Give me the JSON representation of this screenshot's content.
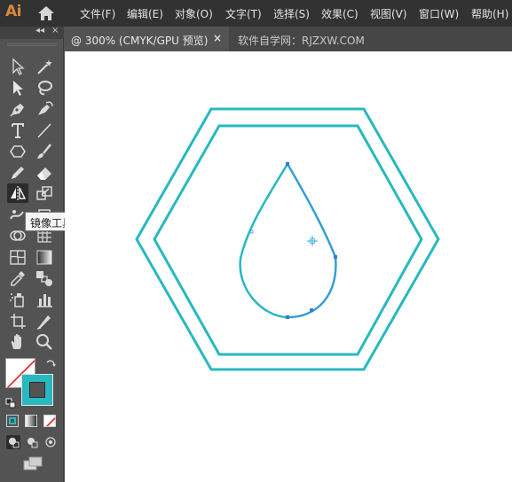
{
  "app": {
    "logo": "Ai"
  },
  "menu": [
    {
      "label": "文件(F)"
    },
    {
      "label": "编辑(E)"
    },
    {
      "label": "对象(O)"
    },
    {
      "label": "文字(T)"
    },
    {
      "label": "选择(S)"
    },
    {
      "label": "效果(C)"
    },
    {
      "label": "视图(V)"
    },
    {
      "label": "窗口(W)"
    },
    {
      "label": "帮助(H)"
    }
  ],
  "tabs": {
    "active_label": "@ 300% (CMYK/GPU 预览)",
    "close_glyph": "×",
    "inactive_label": "软件自学网：RJZXW.COM"
  },
  "toolbar": {
    "collapse_glyph": "◂◂",
    "close_glyph": "×",
    "tooltip": "镜像工具 (O)",
    "tools": [
      {
        "name": "selection-tool",
        "icon": "direct-selection-arrow-outline",
        "interactable": true
      },
      {
        "name": "magic-wand-tool",
        "icon": "magic-wand-icon",
        "interactable": true
      },
      {
        "name": "direct-selection-tool",
        "icon": "solid-arrow-icon",
        "interactable": true
      },
      {
        "name": "lasso-tool",
        "icon": "lasso-icon",
        "interactable": true
      },
      {
        "name": "pen-tool",
        "icon": "pen-icon",
        "interactable": true
      },
      {
        "name": "curvature-tool",
        "icon": "curvature-pen-icon",
        "interactable": true
      },
      {
        "name": "type-tool",
        "icon": "type-icon",
        "interactable": true
      },
      {
        "name": "line-segment-tool",
        "icon": "line-icon",
        "interactable": true
      },
      {
        "name": "shape-tool",
        "icon": "hexagon-icon",
        "interactable": true
      },
      {
        "name": "paintbrush-tool",
        "icon": "brush-icon",
        "interactable": true
      },
      {
        "name": "pencil-tool",
        "icon": "pencil-icon",
        "interactable": true
      },
      {
        "name": "eraser-tool",
        "icon": "eraser-icon",
        "interactable": true
      },
      {
        "name": "reflect-tool",
        "icon": "reflect-icon",
        "interactable": true
      },
      {
        "name": "scale-tool",
        "icon": "scale-icon",
        "interactable": true
      },
      {
        "name": "puppet-warp-tool",
        "icon": "puppet-icon",
        "interactable": true
      },
      {
        "name": "free-transform-tool",
        "icon": "free-transform-icon",
        "interactable": true
      },
      {
        "name": "shape-builder-tool",
        "icon": "shape-builder-icon",
        "interactable": true
      },
      {
        "name": "graph-tool",
        "icon": "graph-grid-icon",
        "interactable": true
      },
      {
        "name": "mesh-tool",
        "icon": "mesh-icon",
        "interactable": true
      },
      {
        "name": "gradient-tool",
        "icon": "gradient-icon",
        "interactable": true
      },
      {
        "name": "eyedropper-tool",
        "icon": "eyedropper-icon",
        "interactable": true
      },
      {
        "name": "blend-tool",
        "icon": "blend-icon",
        "interactable": true
      },
      {
        "name": "symbol-sprayer-tool",
        "icon": "spray-icon",
        "interactable": true
      },
      {
        "name": "column-graph-tool",
        "icon": "bar-graph-icon",
        "interactable": true
      },
      {
        "name": "artboard-tool",
        "icon": "artboard-icon",
        "interactable": true
      },
      {
        "name": "slice-tool",
        "icon": "slice-icon",
        "interactable": true
      },
      {
        "name": "hand-tool",
        "icon": "hand-icon",
        "interactable": true
      },
      {
        "name": "zoom-tool",
        "icon": "zoom-icon",
        "interactable": true
      }
    ]
  },
  "colors": {
    "accent": "#28b8c0",
    "menubar_bg": "#323232",
    "panel_bg": "#535353",
    "canvas_bg": "#ffffff",
    "drop_stroke": "#3a9ad9",
    "app_logo": "#d98a3b"
  }
}
